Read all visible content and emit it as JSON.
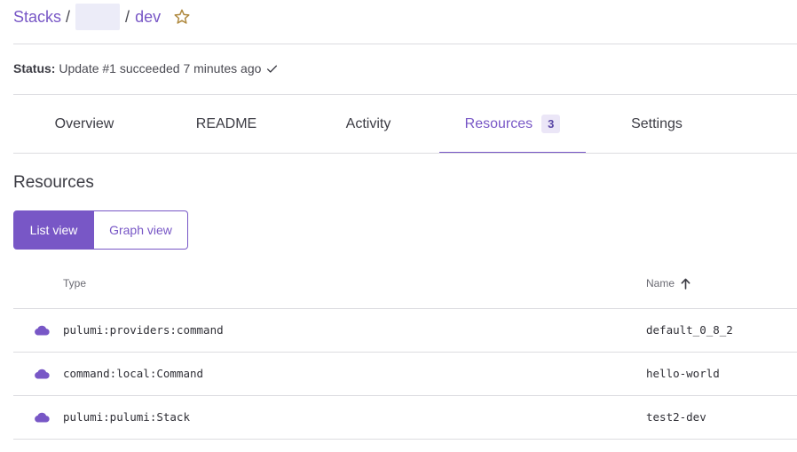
{
  "breadcrumb": {
    "root": "Stacks",
    "separator": "/",
    "stack": "dev"
  },
  "status": {
    "label": "Status:",
    "text": "Update #1 succeeded 7 minutes ago"
  },
  "tabs": [
    {
      "label": "Overview"
    },
    {
      "label": "README"
    },
    {
      "label": "Activity"
    },
    {
      "label": "Resources",
      "count": "3",
      "active": true
    },
    {
      "label": "Settings"
    }
  ],
  "resources": {
    "title": "Resources",
    "view_toggle": {
      "list_label": "List view",
      "graph_label": "Graph view",
      "selected": "List view"
    },
    "columns": {
      "type": "Type",
      "name": "Name",
      "sort": "ascending"
    },
    "rows": [
      {
        "icon": "cloud-icon",
        "type": "pulumi:providers:command",
        "name": "default_0_8_2"
      },
      {
        "icon": "cloud-icon",
        "type": "command:local:Command",
        "name": "hello-world"
      },
      {
        "icon": "cloud-icon",
        "type": "pulumi:pulumi:Stack",
        "name": "test2-dev"
      }
    ]
  },
  "colors": {
    "accent": "#7857c6",
    "star": "#b08a40",
    "badge_bg": "#ebe6f7",
    "divider": "#dcdce0"
  }
}
